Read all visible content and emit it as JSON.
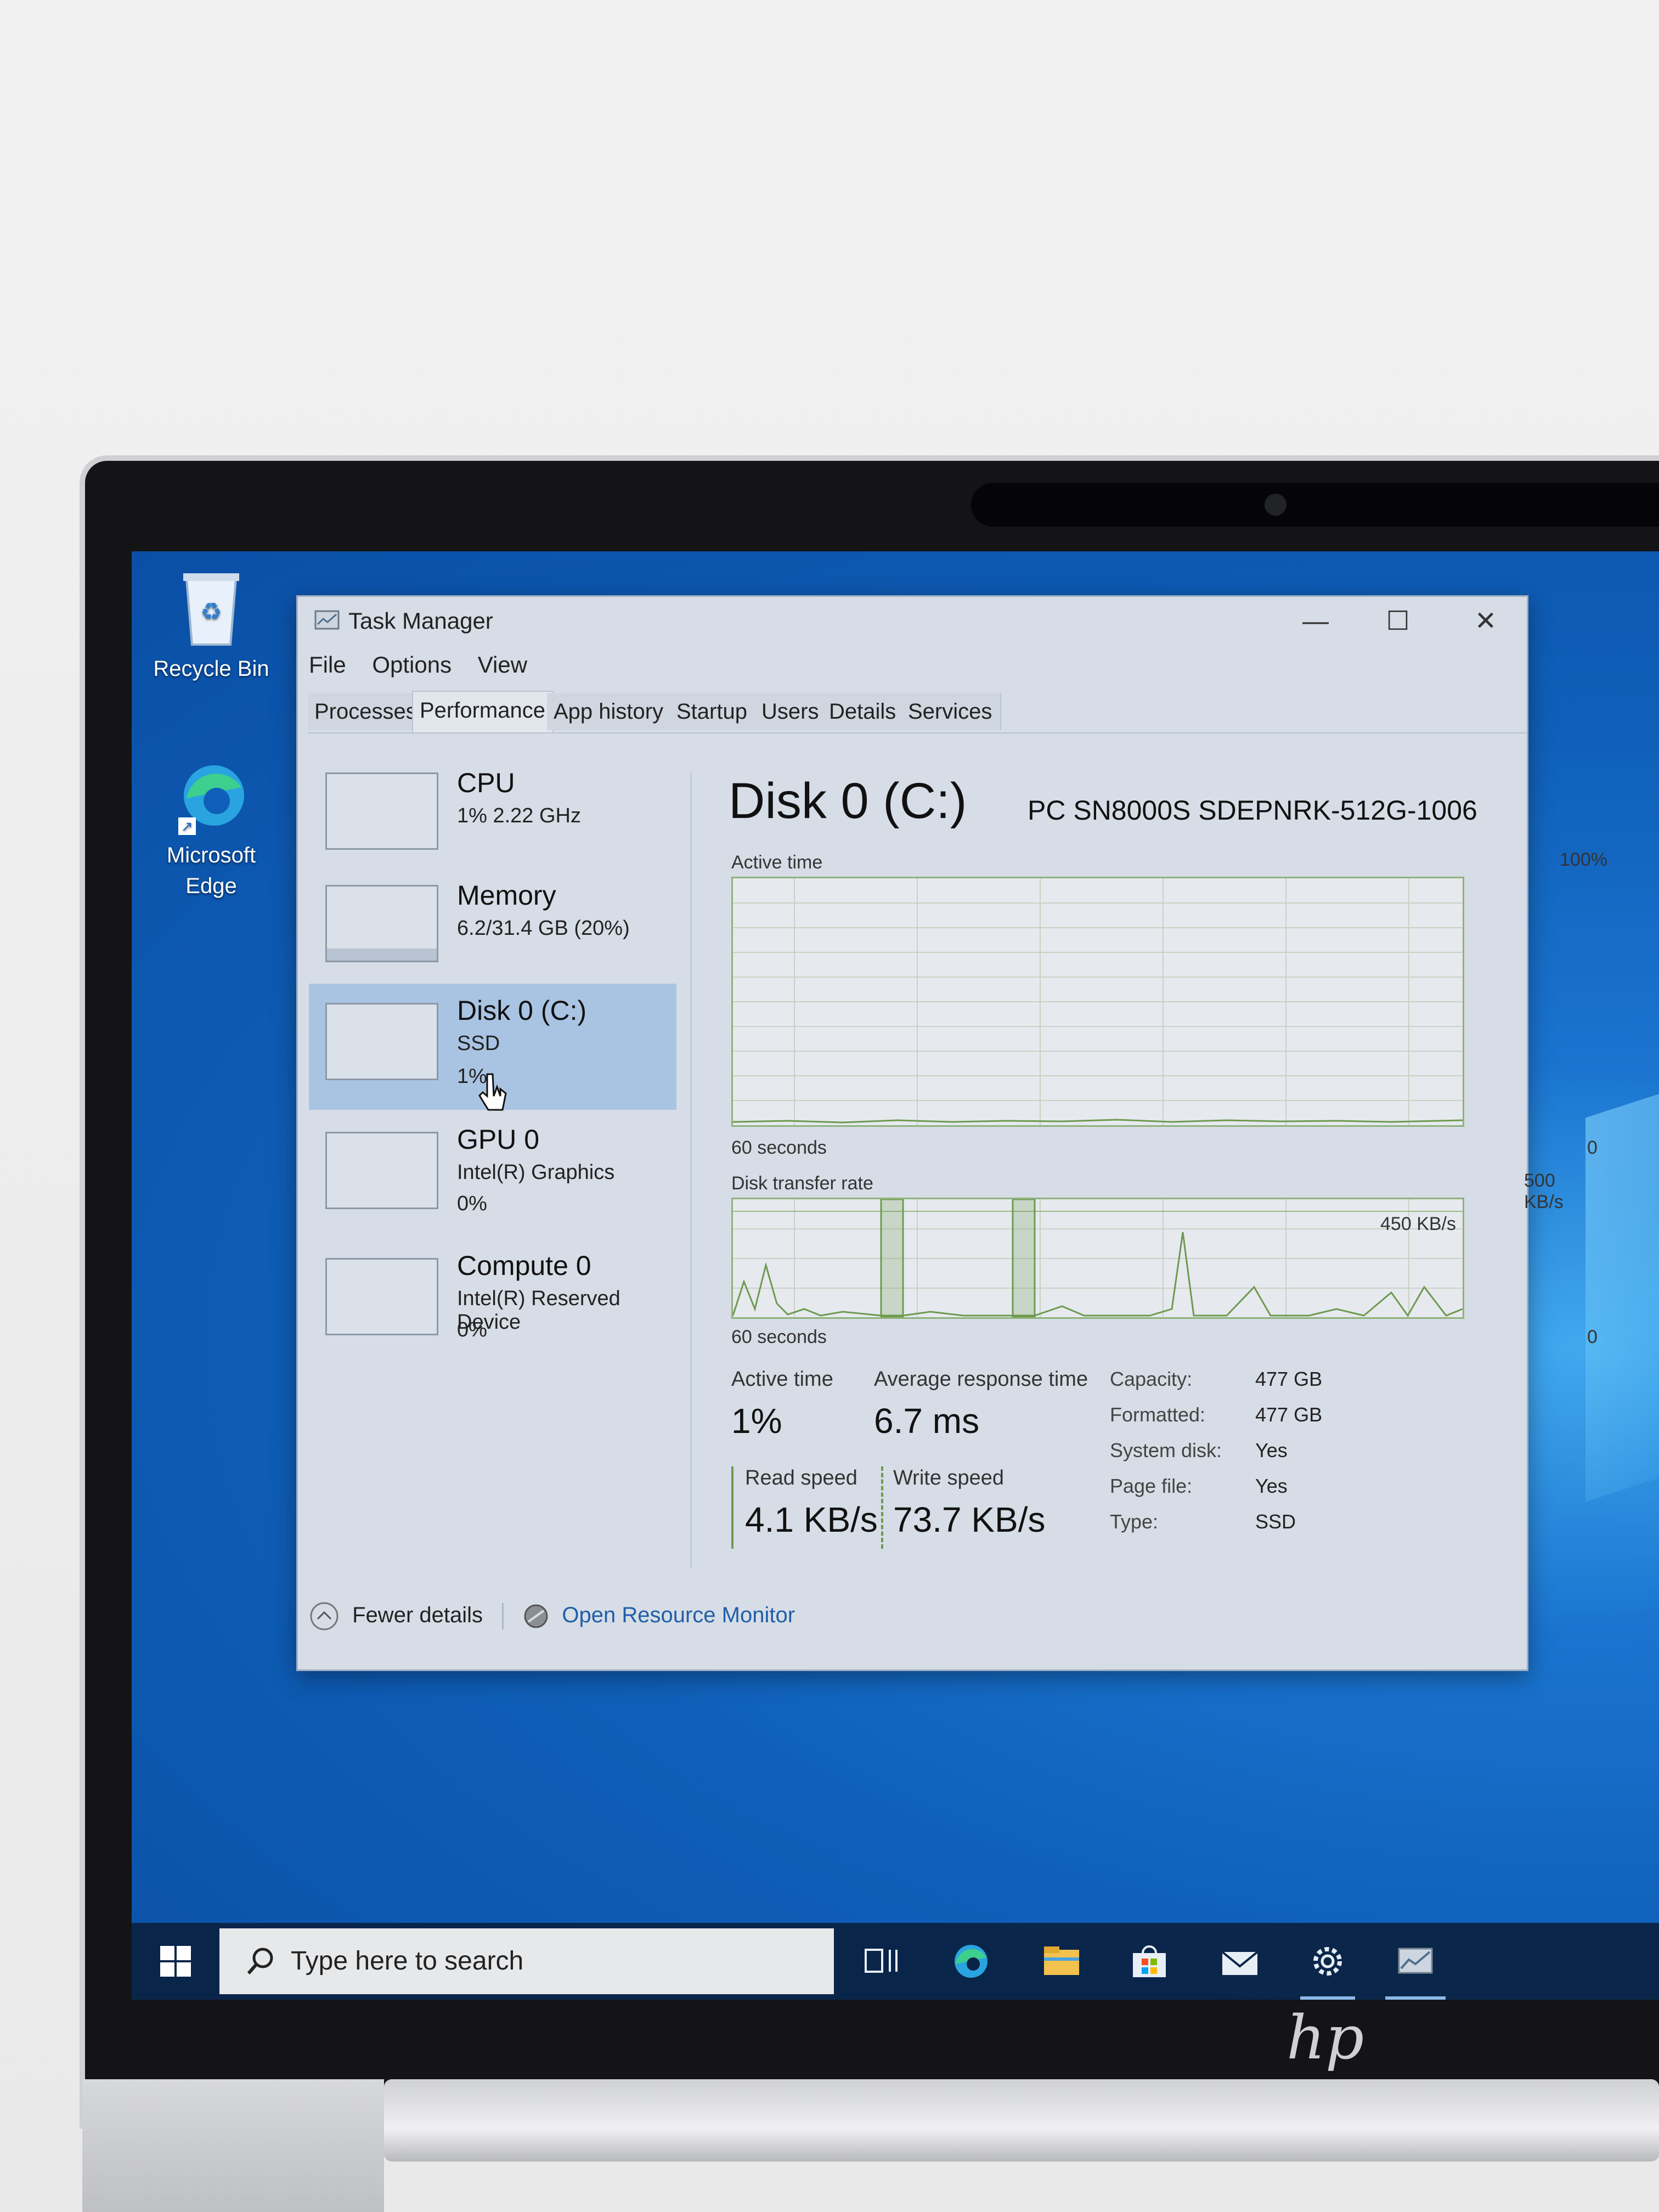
{
  "desktop": {
    "icons": [
      {
        "label": "Recycle Bin"
      },
      {
        "label": "Microsoft Edge"
      }
    ]
  },
  "window": {
    "title": "Task Manager",
    "controls": {
      "minimize": "—",
      "maximize": "☐",
      "close": "✕"
    },
    "menu": [
      "File",
      "Options",
      "View"
    ],
    "tabs": [
      "Processes",
      "Performance",
      "App history",
      "Startup",
      "Users",
      "Details",
      "Services"
    ],
    "active_tab": "Performance"
  },
  "sidebar": {
    "items": [
      {
        "title": "CPU",
        "line1": "1% 2.22 GHz",
        "line2": ""
      },
      {
        "title": "Memory",
        "line1": "6.2/31.4 GB (20%)",
        "line2": ""
      },
      {
        "title": "Disk 0 (C:)",
        "line1": "SSD",
        "line2": "1%"
      },
      {
        "title": "GPU 0",
        "line1": "Intel(R) Graphics",
        "line2": "0%"
      },
      {
        "title": "Compute 0",
        "line1": "Intel(R) Reserved Device",
        "line2": "0%"
      }
    ],
    "selected": "Disk 0 (C:)"
  },
  "main": {
    "title": "Disk 0 (C:)",
    "model": "PC SN8000S SDEPNRK-512G-1006",
    "active_time_graph": {
      "label": "Active time",
      "max_label": "100%",
      "x_left": "60 seconds",
      "x_right": "0"
    },
    "transfer_graph": {
      "label": "Disk transfer rate",
      "max_label": "500 KB/s",
      "ref_line": "450 KB/s",
      "x_left": "60 seconds",
      "x_right": "0"
    },
    "stats": {
      "active_time_label": "Active time",
      "active_time": "1%",
      "avg_response_label": "Average response time",
      "avg_response": "6.7 ms",
      "read_label": "Read speed",
      "read": "4.1 KB/s",
      "write_label": "Write speed",
      "write": "73.7 KB/s"
    },
    "properties": [
      {
        "label": "Capacity:",
        "value": "477 GB"
      },
      {
        "label": "Formatted:",
        "value": "477 GB"
      },
      {
        "label": "System disk:",
        "value": "Yes"
      },
      {
        "label": "Page file:",
        "value": "Yes"
      },
      {
        "label": "Type:",
        "value": "SSD"
      }
    ]
  },
  "footer": {
    "fewer_details": "Fewer details",
    "resource_monitor": "Open Resource Monitor"
  },
  "taskbar": {
    "search_placeholder": "Type here to search",
    "icons": [
      "task-view-icon",
      "edge-icon",
      "file-explorer-icon",
      "store-icon",
      "mail-icon",
      "settings-icon",
      "task-manager-icon"
    ]
  },
  "brand": {
    "laptop_logo": "hp"
  },
  "colors": {
    "accent": "#1a74cf",
    "selection": "#a9c4e2",
    "graph_line": "#6e9a4f",
    "link": "#1f5fa8"
  }
}
